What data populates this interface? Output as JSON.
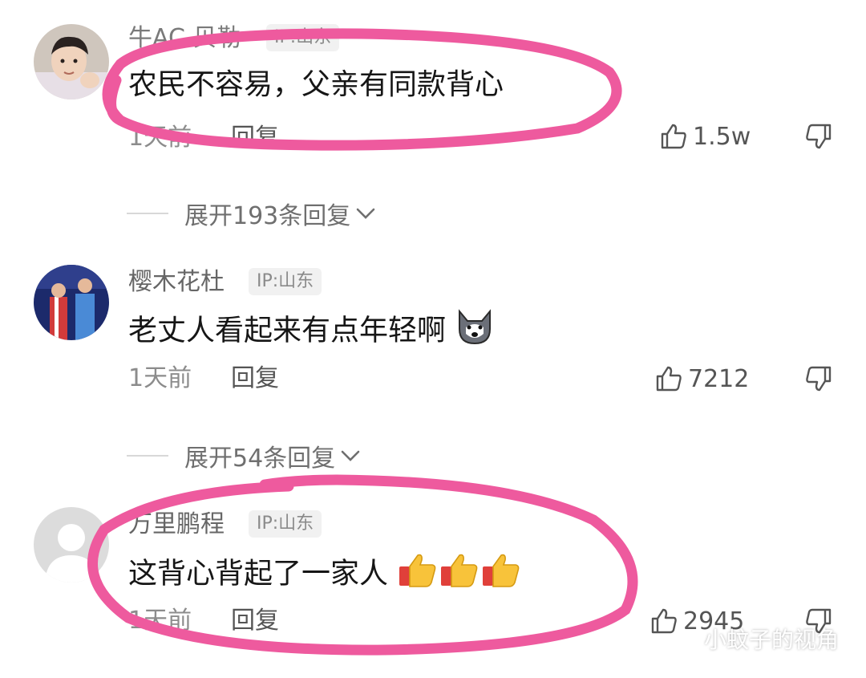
{
  "colors": {
    "highlight": "#ee5a9e",
    "meta": "#8c8c8c",
    "username": "#7a7a7a"
  },
  "comments": [
    {
      "username": "牛AC 贝勒",
      "ip": "IP:山东",
      "text": "农民不容易，父亲有同款背心",
      "time": "1天前",
      "reply": "回复",
      "likes": "1.5w",
      "expand": "展开193条回复"
    },
    {
      "username": "樱木花杜",
      "ip": "IP:山东",
      "text": "老丈人看起来有点年轻啊",
      "time": "1天前",
      "reply": "回复",
      "likes": "7212",
      "expand": "展开54条回复"
    },
    {
      "username": "万里鹏程",
      "ip": "IP:山东",
      "text": "这背心背起了一家人",
      "time": "1天前",
      "reply": "回复",
      "likes": "2945"
    }
  ],
  "watermark": "小蚊子的视角",
  "icons": {
    "like": "thumbs-up-outline-icon",
    "dislike": "thumbs-down-outline-icon",
    "chevron": "chevron-down-icon",
    "wolf_emoji": "wolf-face-emoji-icon",
    "thumbs_emoji": "thumbs-up-emoji-icon",
    "wechat": "wechat-logo-icon"
  }
}
